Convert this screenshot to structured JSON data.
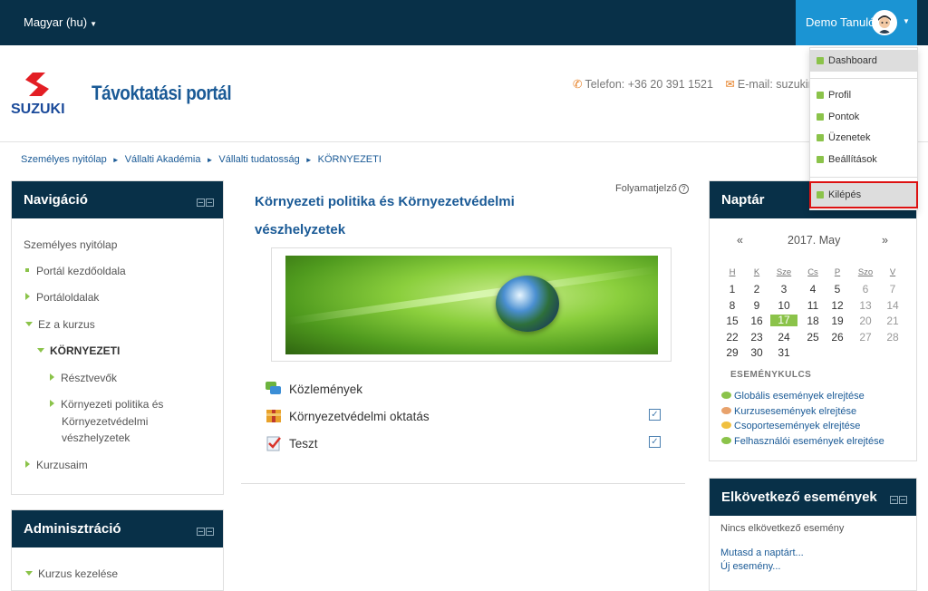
{
  "topbar": {
    "language": "Magyar (hu)",
    "user_name": "Demo Tanuló"
  },
  "header": {
    "logo_text": "SUZUKI",
    "site_title": "Távoktatási portál",
    "phone": "Telefon: +36 20 391 1521",
    "email": "E-mail: suzukimo"
  },
  "breadcrumb": [
    "Személyes nyitólap",
    "Vállalti Akadémia",
    "Vállalti tudatosság",
    "KÖRNYEZETI"
  ],
  "navigation": {
    "title": "Navigáció",
    "items": [
      {
        "label": "Személyes nyitólap"
      },
      {
        "label": "Portál kezdőoldala"
      },
      {
        "label": "Portáloldalak"
      },
      {
        "label": "Ez a kurzus"
      },
      {
        "label": "KÖRNYEZETI"
      },
      {
        "label": "Résztvevők"
      },
      {
        "label": "Környezeti politika és"
      },
      {
        "label": "Környezetvédelmi"
      },
      {
        "label": "vészhelyzetek"
      },
      {
        "label": "Kurzusaim"
      }
    ]
  },
  "administration": {
    "title": "Adminisztráció",
    "items": [
      {
        "label": "Kurzus kezelése"
      }
    ]
  },
  "main": {
    "course_title_line1": "Környezeti politika és Környezetvédelmi",
    "course_title_line2": "vészhelyzetek",
    "progress_label": "Folyamatjelző",
    "activities": [
      {
        "label": "Közlemények",
        "icon": "forum-icon",
        "completion": false
      },
      {
        "label": "Környezetvédelmi oktatás",
        "icon": "package-icon",
        "completion": true
      },
      {
        "label": "Teszt",
        "icon": "quiz-icon",
        "completion": true
      }
    ]
  },
  "calendar": {
    "title": "Naptár",
    "prev": "«",
    "next": "»",
    "month": "2017. May",
    "weekdays": [
      "H",
      "K",
      "Sze",
      "Cs",
      "P",
      "Szo",
      "V"
    ],
    "weeks": [
      [
        "1",
        "2",
        "3",
        "4",
        "5",
        "6",
        "7"
      ],
      [
        "8",
        "9",
        "10",
        "11",
        "12",
        "13",
        "14"
      ],
      [
        "15",
        "16",
        "17",
        "18",
        "19",
        "20",
        "21"
      ],
      [
        "22",
        "23",
        "24",
        "25",
        "26",
        "27",
        "28"
      ],
      [
        "29",
        "30",
        "31",
        "",
        "",
        "",
        ""
      ]
    ],
    "today": "17",
    "event_key_title": "ESEMÉNYKULCS",
    "event_links": [
      {
        "label": "Globális események elrejtése",
        "color": "#8bc34a"
      },
      {
        "label": "Kurzusesemények elrejtése",
        "color": "#e8a26c"
      },
      {
        "label": "Csoportesemények elrejtése",
        "color": "#f0c040"
      },
      {
        "label": "Felhasználói események elrejtése",
        "color": "#8bc34a"
      }
    ]
  },
  "upcoming": {
    "title": "Elkövetkező események",
    "empty": "Nincs elkövetkező esemény",
    "link_calendar": "Mutasd a naptárt...",
    "link_new": "Új esemény..."
  },
  "user_dropdown": {
    "items": [
      {
        "label": "Dashboard"
      },
      {
        "label": "Profil"
      },
      {
        "label": "Pontok"
      },
      {
        "label": "Üzenetek"
      },
      {
        "label": "Beállítások"
      },
      {
        "label": "Kilépés"
      }
    ]
  },
  "colors": {
    "navbar": "#083048",
    "accent": "#1b94d3",
    "link": "#1a5a96",
    "green": "#8bc34a"
  }
}
